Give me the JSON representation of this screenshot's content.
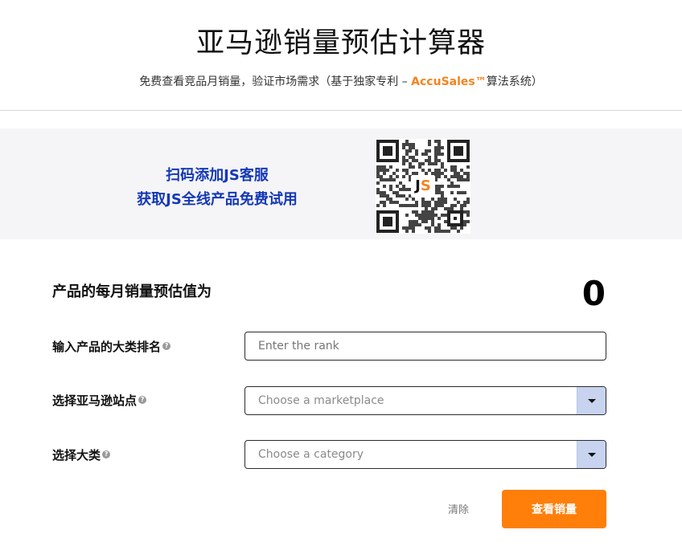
{
  "header": {
    "title": "亚马逊销量预估计算器",
    "subtitle_prefix": "免费查看竞品月销量，验证市场需求（基于独家专利 – ",
    "subtitle_brand": "AccuSales™",
    "subtitle_suffix": "算法系统）"
  },
  "banner": {
    "line1": "扫码添加JS客服",
    "line2": "获取JS全线产品免费试用",
    "qr_logo_j": "J",
    "qr_logo_s": "S"
  },
  "result": {
    "label": "产品的每月销量预估值为",
    "value": "0"
  },
  "form": {
    "rank": {
      "label": "输入产品的大类排名",
      "placeholder": "Enter the rank",
      "value": ""
    },
    "marketplace": {
      "label": "选择亚马逊站点",
      "placeholder": "Choose a marketplace"
    },
    "category": {
      "label": "选择大类",
      "placeholder": "Choose a category"
    },
    "help_glyph": "?"
  },
  "actions": {
    "clear_label": "清除",
    "submit_label": "查看销量"
  },
  "colors": {
    "brand_orange": "#ff7f0a",
    "banner_blue": "#1538b5",
    "select_arrow_bg": "#c8d3f0"
  }
}
